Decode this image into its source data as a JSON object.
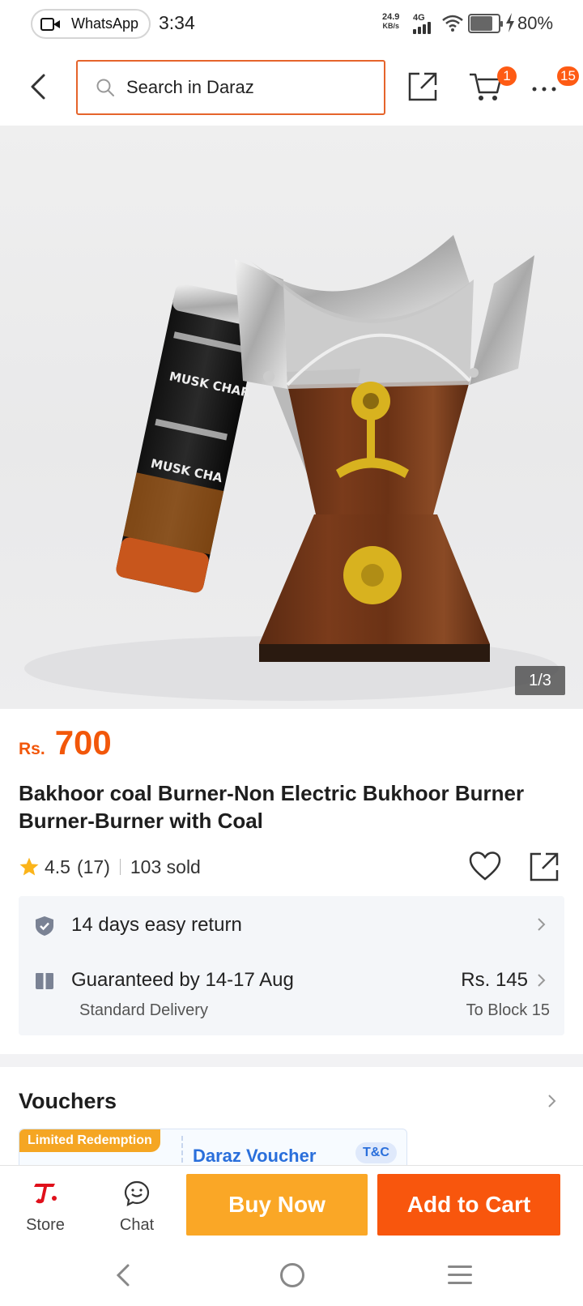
{
  "status_bar": {
    "notification_app": "WhatsApp",
    "time": "3:34",
    "net_speed_value": "24.9",
    "net_speed_unit": "KB/s",
    "network": "4G",
    "battery": "80%",
    "battery_level": 0.8
  },
  "header": {
    "search_placeholder": "Search in Daraz",
    "cart_count": "1",
    "more_count": "15"
  },
  "gallery": {
    "counter": "1/3"
  },
  "product": {
    "currency": "Rs.",
    "price": "700",
    "title": "Bakhoor coal Burner-Non Electric Bukhoor Burner Burner-Burner with Coal",
    "rating": "4.5",
    "reviews": "(17)",
    "sold": "103 sold"
  },
  "service": {
    "return_text": "14 days easy return",
    "delivery_text": "Guaranteed by 14-17 Aug",
    "delivery_type": "Standard Delivery",
    "delivery_fee": "Rs. 145",
    "delivery_destination": "To Block 15"
  },
  "vouchers": {
    "title": "Vouchers",
    "tag": "Limited Redemption",
    "name": "Daraz Voucher",
    "tnc": "T&C"
  },
  "action_bar": {
    "store_label": "Store",
    "chat_label": "Chat",
    "buy_now_label": "Buy Now",
    "add_to_cart_label": "Add to Cart"
  },
  "colors": {
    "accent": "#f8560d",
    "buy_now": "#faa726",
    "price": "#f2570a",
    "voucher_blue": "#2a6fdb"
  }
}
